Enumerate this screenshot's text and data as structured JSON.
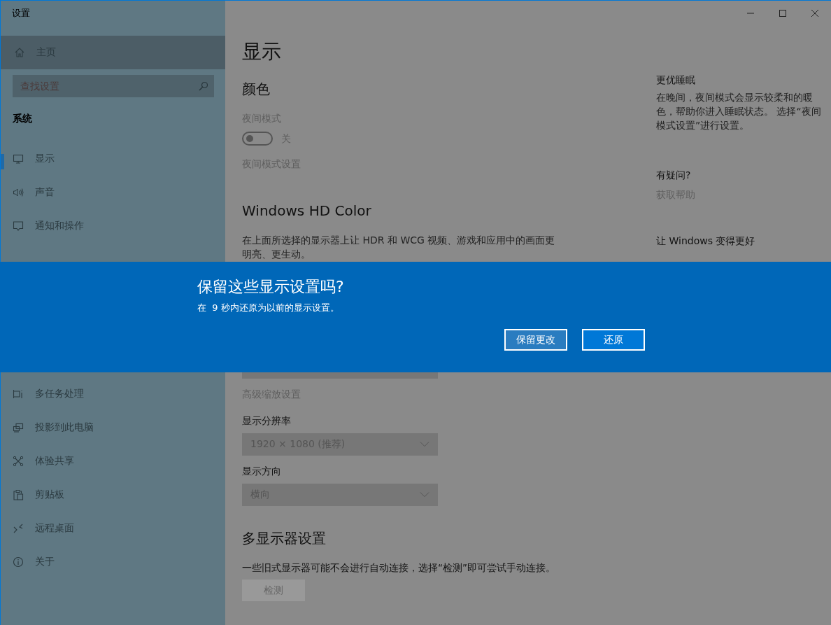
{
  "window": {
    "title": "设置"
  },
  "sidebar": {
    "home": "主页",
    "search": {
      "placeholder": "查找设置"
    },
    "section": "系统",
    "items_above_dialog": [
      {
        "label": "显示",
        "selected": true
      },
      {
        "label": "声音",
        "selected": false
      },
      {
        "label": "通知和操作",
        "selected": false
      }
    ],
    "items_below_dialog": [
      {
        "label": "多任务处理",
        "selected": false
      },
      {
        "label": "投影到此电脑",
        "selected": false
      },
      {
        "label": "体验共享",
        "selected": false
      },
      {
        "label": "剪贴板",
        "selected": false
      },
      {
        "label": "远程桌面",
        "selected": false
      },
      {
        "label": "关于",
        "selected": false
      }
    ]
  },
  "page": {
    "title": "显示",
    "color_heading": "颜色",
    "night_light": {
      "label": "夜间模式",
      "on": false,
      "state_text": "关"
    },
    "night_light_link": "夜间模式设置",
    "hdr_heading": "Windows HD Color",
    "hdr_text": "在上面所选择的显示器上让 HDR 和 WCG 视频、游戏和应用中的画面更明亮、更生动。",
    "scaling_link": "高级缩放设置",
    "resolution": {
      "label": "显示分辨率",
      "value": "1920 × 1080 (推荐)"
    },
    "orientation": {
      "label": "显示方向",
      "value": "横向"
    },
    "multi_heading": "多显示器设置",
    "multi_text": "一些旧式显示器可能不会进行自动连接，选择“检测”即可尝试手动连接。",
    "detect_button": "检测"
  },
  "aside": [
    {
      "heading": "更优睡眠",
      "text": "在晚间，夜间模式会显示较柔和的暖色，帮助你进入睡眠状态。 选择“夜间模式设置”进行设置。"
    },
    {
      "heading": "有疑问?",
      "link": "获取帮助"
    },
    {
      "heading": "让 Windows 变得更好"
    }
  ],
  "dialog": {
    "title": "保留这些显示设置吗?",
    "message": "在  9 秒内还原为以前的显示设置。",
    "buttons": [
      {
        "label": "保留更改",
        "kind": "secondary"
      },
      {
        "label": "还原",
        "kind": "primary"
      }
    ]
  }
}
